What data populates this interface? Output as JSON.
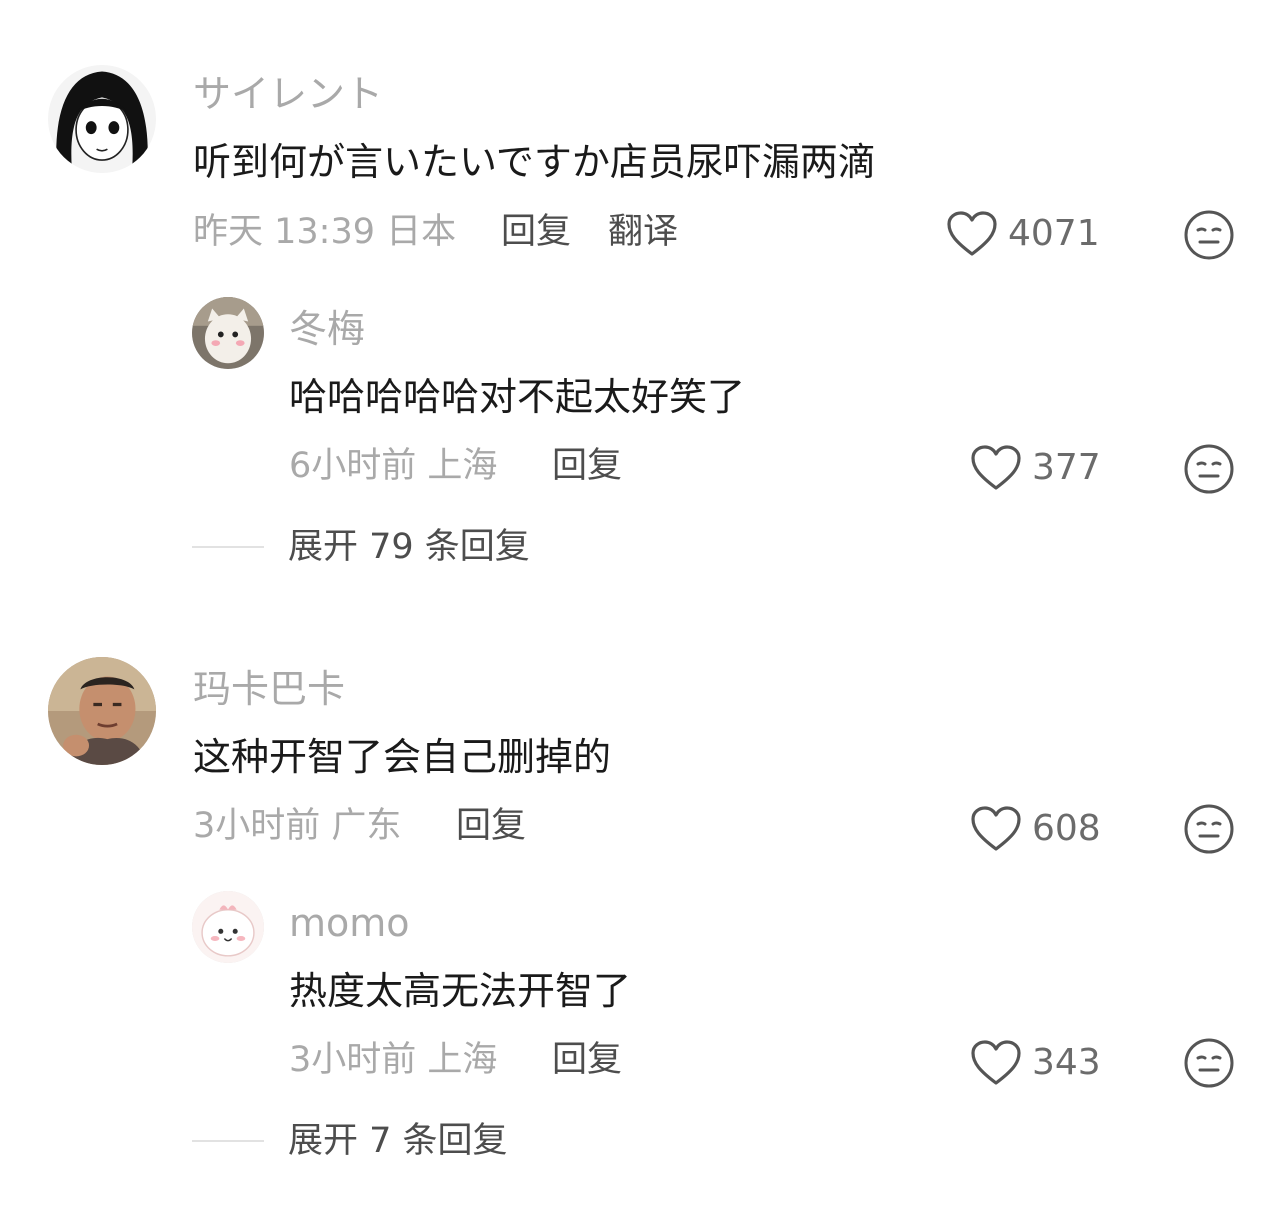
{
  "comments": [
    {
      "author": "サイレント",
      "text": "听到何が言いたいですか店员尿吓漏两滴",
      "time": "昨天 13:39 日本",
      "reply_label": "回复",
      "translate_label": "翻译",
      "likes": "4071",
      "replies": [
        {
          "author": "冬梅",
          "text": "哈哈哈哈哈对不起太好笑了",
          "time": "6小时前 上海",
          "reply_label": "回复",
          "likes": "377"
        }
      ],
      "expand_label": "展开 79 条回复"
    },
    {
      "author": "玛卡巴卡",
      "text": "这种开智了会自己删掉的",
      "time": "3小时前 广东",
      "reply_label": "回复",
      "likes": "608",
      "replies": [
        {
          "author": "momo",
          "text": "热度太高无法开智了",
          "time": "3小时前 上海",
          "reply_label": "回复",
          "likes": "343"
        }
      ],
      "expand_label": "展开 7 条回复"
    }
  ],
  "icons": {
    "like": "heart-outline-icon",
    "emoji": "neutral-face-icon"
  },
  "colors": {
    "text": "#1a1a1a",
    "meta": "#a9a9a9",
    "action": "#4d4d4d"
  }
}
